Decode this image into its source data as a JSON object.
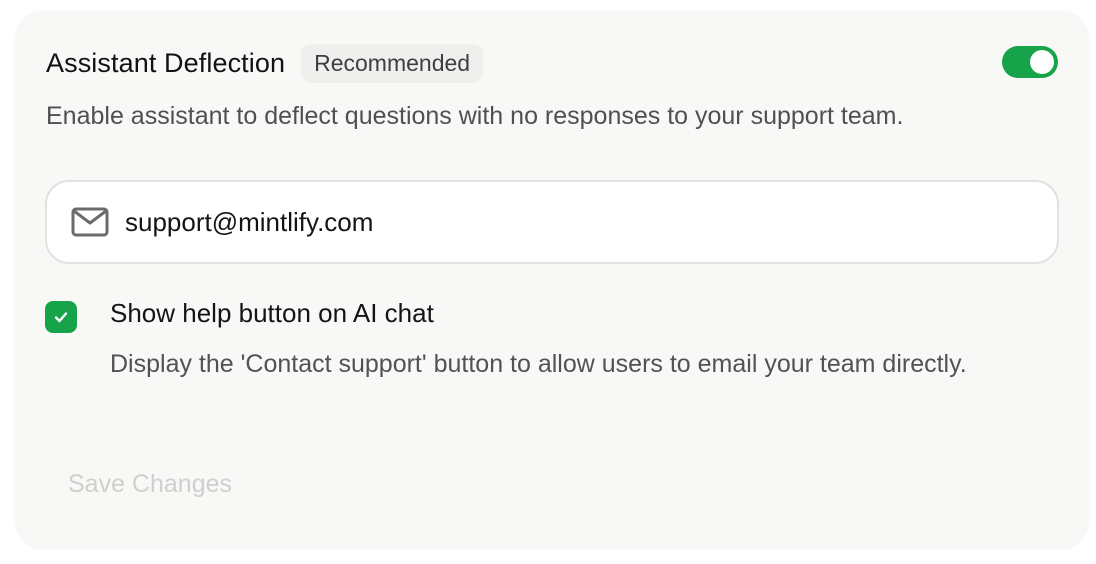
{
  "section": {
    "title": "Assistant Deflection",
    "badge": "Recommended",
    "toggle_enabled": true,
    "description": "Enable assistant to deflect questions with no responses to your support team."
  },
  "email": {
    "icon": "mail-icon",
    "value": "support@mintlify.com"
  },
  "help_option": {
    "checked": true,
    "label": "Show help button on AI chat",
    "description": "Display the 'Contact support' button to allow users to email your team directly."
  },
  "actions": {
    "save_label": "Save Changes"
  },
  "colors": {
    "accent": "#16a34a",
    "card_background": "#f8f8f7",
    "badge_background": "#efefed",
    "disabled_text": "#cfcfcd"
  }
}
